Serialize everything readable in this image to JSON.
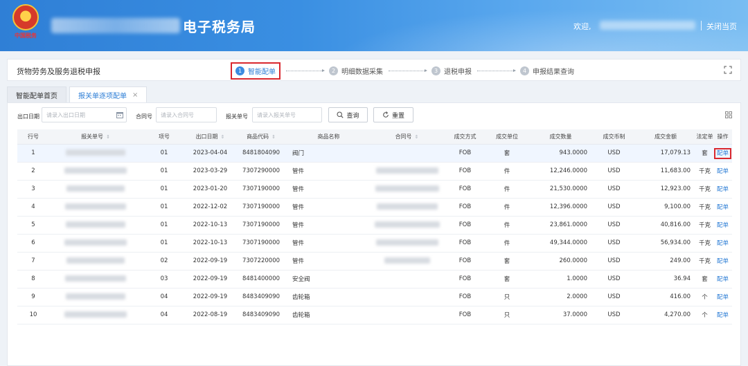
{
  "header": {
    "emblem_text": "中国税务",
    "app_title": "电子税务局",
    "welcome": "欢迎,",
    "close_page": "关闭当页"
  },
  "page": {
    "name": "货物劳务及服务退税申报",
    "steps": [
      {
        "num": "1",
        "label": "智能配单",
        "active": true
      },
      {
        "num": "2",
        "label": "明细数据采集",
        "active": false
      },
      {
        "num": "3",
        "label": "退税申报",
        "active": false
      },
      {
        "num": "4",
        "label": "申报结果查询",
        "active": false
      }
    ]
  },
  "tabs": [
    {
      "label": "智能配单首页",
      "active": false,
      "closable": false
    },
    {
      "label": "报关单逐项配单",
      "active": true,
      "closable": true
    }
  ],
  "filters": {
    "export_date_label": "出口日期",
    "export_date_placeholder": "请录入出口日期",
    "contract_label": "合同号",
    "contract_placeholder": "请录入合同号",
    "customs_label": "报关单号",
    "customs_placeholder": "请录入报关单号",
    "query_label": "查询",
    "reset_label": "重置"
  },
  "table": {
    "columns": [
      "行号",
      "报关单号",
      "项号",
      "出口日期",
      "商品代码",
      "商品名称",
      "合同号",
      "成交方式",
      "成交单位",
      "成交数量",
      "成交币制",
      "成交金额",
      "法定单",
      "操作"
    ],
    "action_label": "配单",
    "rows": [
      {
        "line": "1",
        "item": "01",
        "date": "2023-04-04",
        "code": "8481804090",
        "name": "阀门",
        "method": "FOB",
        "unit": "套",
        "qty": "943.0000",
        "currency": "USD",
        "amount": "17,079.13",
        "legal": "套"
      },
      {
        "line": "2",
        "item": "01",
        "date": "2023-03-29",
        "code": "7307290000",
        "name": "管件",
        "method": "FOB",
        "unit": "件",
        "qty": "12,246.0000",
        "currency": "USD",
        "amount": "11,683.00",
        "legal": "千克"
      },
      {
        "line": "3",
        "item": "01",
        "date": "2023-01-20",
        "code": "7307190000",
        "name": "管件",
        "method": "FOB",
        "unit": "件",
        "qty": "21,530.0000",
        "currency": "USD",
        "amount": "12,923.00",
        "legal": "千克"
      },
      {
        "line": "4",
        "item": "01",
        "date": "2022-12-02",
        "code": "7307190000",
        "name": "管件",
        "method": "FOB",
        "unit": "件",
        "qty": "12,396.0000",
        "currency": "USD",
        "amount": "9,100.00",
        "legal": "千克"
      },
      {
        "line": "5",
        "item": "01",
        "date": "2022-10-13",
        "code": "7307190000",
        "name": "管件",
        "method": "FOB",
        "unit": "件",
        "qty": "23,861.0000",
        "currency": "USD",
        "amount": "40,816.00",
        "legal": "千克"
      },
      {
        "line": "6",
        "item": "01",
        "date": "2022-10-13",
        "code": "7307190000",
        "name": "管件",
        "method": "FOB",
        "unit": "件",
        "qty": "49,344.0000",
        "currency": "USD",
        "amount": "56,934.00",
        "legal": "千克"
      },
      {
        "line": "7",
        "item": "02",
        "date": "2022-09-19",
        "code": "7307220000",
        "name": "管件",
        "method": "FOB",
        "unit": "套",
        "qty": "260.0000",
        "currency": "USD",
        "amount": "249.00",
        "legal": "千克"
      },
      {
        "line": "8",
        "item": "03",
        "date": "2022-09-19",
        "code": "8481400000",
        "name": "安全阀",
        "method": "FOB",
        "unit": "套",
        "qty": "1.0000",
        "currency": "USD",
        "amount": "36.94",
        "legal": "套"
      },
      {
        "line": "9",
        "item": "04",
        "date": "2022-09-19",
        "code": "8483409090",
        "name": "齿轮箱",
        "method": "FOB",
        "unit": "只",
        "qty": "2.0000",
        "currency": "USD",
        "amount": "416.00",
        "legal": "个"
      },
      {
        "line": "10",
        "item": "04",
        "date": "2022-08-19",
        "code": "8483409090",
        "name": "齿轮箱",
        "method": "FOB",
        "unit": "只",
        "qty": "37.0000",
        "currency": "USD",
        "amount": "4,270.00",
        "legal": "个"
      }
    ]
  },
  "colors": {
    "accent": "#2f7fd6",
    "highlight": "#d9272e",
    "header": "#3a8fe2"
  },
  "icons": {
    "expand": "expand-icon",
    "calendar": "calendar-icon",
    "search": "search-icon",
    "reset": "refresh-icon",
    "columns": "grid-icon"
  }
}
